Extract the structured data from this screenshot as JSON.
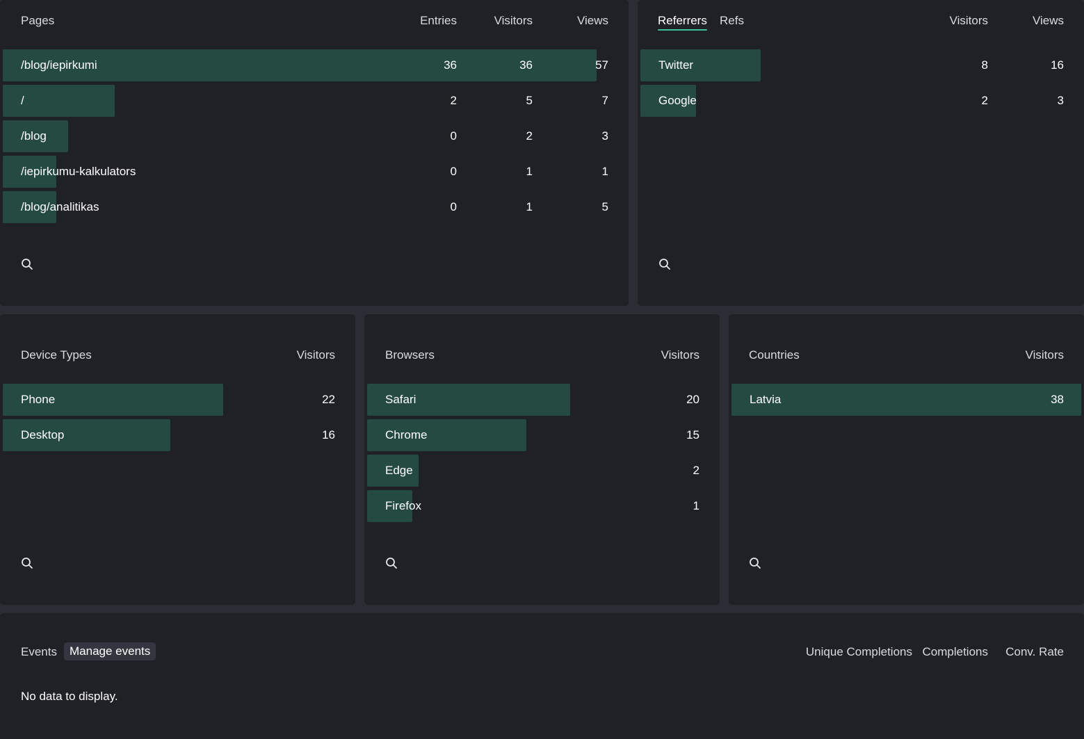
{
  "pages": {
    "title": "Pages",
    "columns": [
      "Entries",
      "Visitors",
      "Views"
    ],
    "rows": [
      {
        "label": "/blog/iepirkumi",
        "entries": "36",
        "visitors": "36",
        "views": "57",
        "share": 1.0
      },
      {
        "label": "/",
        "entries": "2",
        "visitors": "5",
        "views": "7",
        "share": 0.188
      },
      {
        "label": "/blog",
        "entries": "0",
        "visitors": "2",
        "views": "3",
        "share": 0.11
      },
      {
        "label": "/iepirkumu-kalkulators",
        "entries": "0",
        "visitors": "1",
        "views": "1",
        "share": 0.09
      },
      {
        "label": "/blog/analitikas",
        "entries": "0",
        "visitors": "1",
        "views": "5",
        "share": 0.09
      }
    ]
  },
  "referrers": {
    "tabs": [
      "Referrers",
      "Refs"
    ],
    "active_tab": "Referrers",
    "columns": [
      "Visitors",
      "Views"
    ],
    "rows": [
      {
        "label": "Twitter",
        "visitors": "8",
        "views": "16",
        "share": 0.27
      },
      {
        "label": "Google",
        "visitors": "2",
        "views": "3",
        "share": 0.125
      }
    ]
  },
  "devices": {
    "title": "Device Types",
    "column": "Visitors",
    "rows": [
      {
        "label": "Phone",
        "visitors": "22",
        "share": 0.63
      },
      {
        "label": "Desktop",
        "visitors": "16",
        "share": 0.48
      }
    ]
  },
  "browsers": {
    "title": "Browsers",
    "column": "Visitors",
    "rows": [
      {
        "label": "Safari",
        "visitors": "20",
        "share": 0.58
      },
      {
        "label": "Chrome",
        "visitors": "15",
        "share": 0.455
      },
      {
        "label": "Edge",
        "visitors": "2",
        "share": 0.147
      },
      {
        "label": "Firefox",
        "visitors": "1",
        "share": 0.129
      }
    ]
  },
  "countries": {
    "title": "Countries",
    "column": "Visitors",
    "rows": [
      {
        "label": "Latvia",
        "visitors": "38",
        "share": 1.0
      }
    ]
  },
  "events": {
    "title": "Events",
    "manage_label": "Manage events",
    "columns": [
      "Unique Completions",
      "Completions",
      "Conv. Rate"
    ],
    "empty_text": "No data to display."
  },
  "colors": {
    "bar": "#244a42",
    "accent": "#3fbf94",
    "panel": "#202127",
    "background": "#2b2d34"
  },
  "icons": {
    "search": "search-icon"
  }
}
